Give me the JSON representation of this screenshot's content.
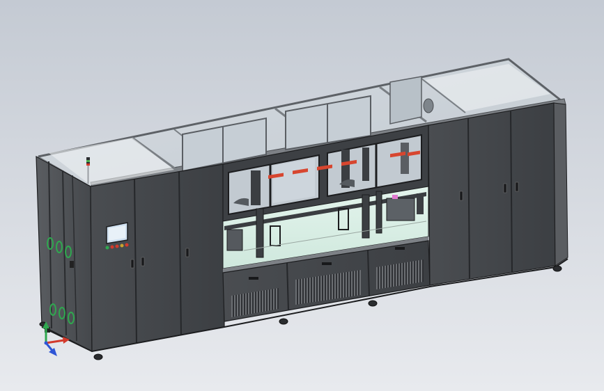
{
  "viewport": {
    "background_top": "#c4cad3",
    "background_bottom": "#e7e9ed",
    "model_body_color": "#45484c",
    "model_panel_color": "#3a3d41",
    "model_edge_color": "#1c1d1f",
    "glass_color": "#cfd6dc",
    "frame_color": "#8c9196",
    "platform_color": "#dff2ea",
    "conveyor_accent": "#d7462f",
    "triad_x_color": "#d33a2c",
    "triad_y_color": "#2fa84f",
    "triad_z_color": "#2e55d6"
  },
  "triad": {
    "x_icon": "axis-x-arrow",
    "y_icon": "axis-y-arrow",
    "z_icon": "axis-z-arrow"
  },
  "status_light_icon": "signal-tower-icon",
  "hmi_icon": "touch-screen-icon"
}
